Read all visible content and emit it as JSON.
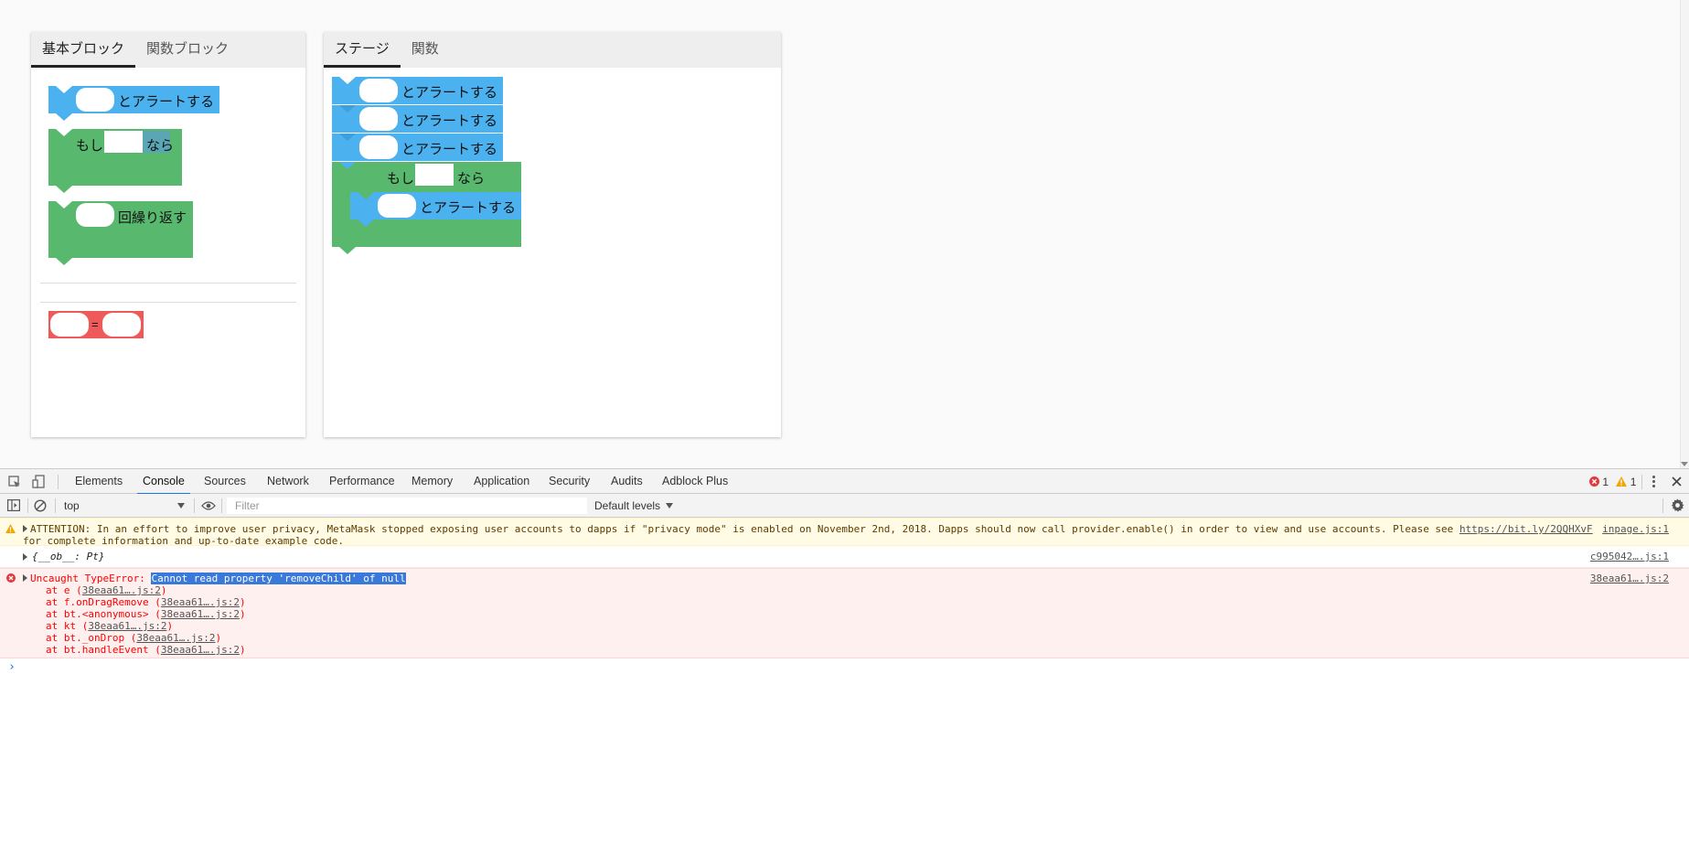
{
  "left_panel": {
    "tabs": [
      {
        "label": "基本ブロック",
        "active": true
      },
      {
        "label": "関数ブロック",
        "active": false
      }
    ],
    "blocks": {
      "alert_text": "とアラートする",
      "if_prefix": "もし",
      "if_suffix": "なら",
      "repeat_text": "回繰り返す",
      "equals_text": "="
    }
  },
  "right_panel": {
    "tabs": [
      {
        "label": "ステージ",
        "active": true
      },
      {
        "label": "関数",
        "active": false
      }
    ],
    "blocks": {
      "alert_1": "とアラートする",
      "alert_2": "とアラートする",
      "alert_3": "とアラートする",
      "if_prefix": "もし",
      "if_suffix": "なら",
      "nested_alert": "とアラートする"
    }
  },
  "devtools": {
    "tabs": [
      "Elements",
      "Console",
      "Sources",
      "Network",
      "Performance",
      "Memory",
      "Application",
      "Security",
      "Audits",
      "Adblock Plus"
    ],
    "active_tab": "Console",
    "error_count": "1",
    "warning_count": "1",
    "context": "top",
    "filter_placeholder": "Filter",
    "levels": "Default levels",
    "messages": {
      "warning": {
        "text_1": "ATTENTION: In an effort to improve user privacy, MetaMask stopped exposing user accounts to dapps if \"privacy mode\" is enabled on November 2nd, 2018. Dapps should now call provider.enable() in order to view and use accounts. Please see ",
        "link": "https://bit.ly/2QQHXvF",
        "text_2": "for complete information and up-to-date example code.",
        "source": "inpage.js:1"
      },
      "log": {
        "text": "{__ob__: Pt}",
        "source": "c995042….js:1"
      },
      "error": {
        "prefix": "Uncaught TypeError: ",
        "highlighted": "Cannot read property 'removeChild' of null",
        "source": "38eaa61….js:2",
        "stack": [
          {
            "fn": "at e (",
            "src": "38eaa61….js:2",
            "end": ")"
          },
          {
            "fn": "at f.onDragRemove (",
            "src": "38eaa61….js:2",
            "end": ")"
          },
          {
            "fn": "at bt.<anonymous> (",
            "src": "38eaa61….js:2",
            "end": ")"
          },
          {
            "fn": "at kt (",
            "src": "38eaa61….js:2",
            "end": ")"
          },
          {
            "fn": "at bt._onDrop (",
            "src": "38eaa61….js:2",
            "end": ")"
          },
          {
            "fn": "at bt.handleEvent (",
            "src": "38eaa61….js:2",
            "end": ")"
          }
        ]
      }
    },
    "prompt": "›"
  },
  "colors": {
    "alert_block": "#4bb1ef",
    "control_block": "#58b96e",
    "operator_block": "#ee5a5a",
    "active_tab_underline": "#1a73e8"
  }
}
